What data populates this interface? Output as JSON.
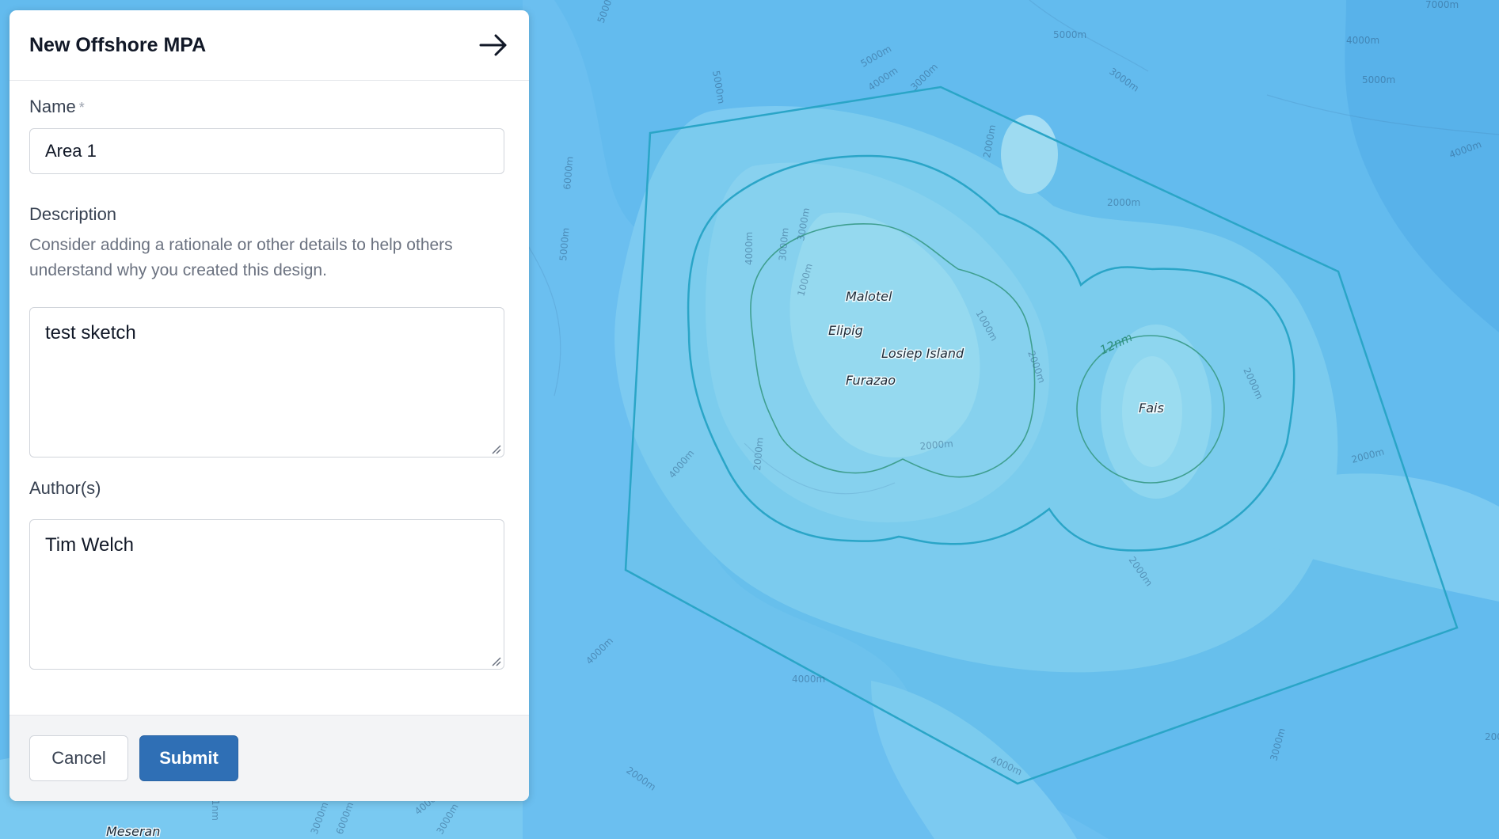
{
  "map": {
    "places": [
      "Malotel",
      "Elipig",
      "Losiep Island",
      "Furazao",
      "Fais",
      "Meseran"
    ],
    "nm_label": "12nm",
    "contour_labels": [
      "5000m",
      "4000m",
      "3000m",
      "2000m",
      "1000m",
      "7000m",
      "6000m",
      "1nm"
    ],
    "colors": {
      "deep": "#5bb6ec",
      "mid": "#72c4f0",
      "shallow": "#92d4f3",
      "outline": "#2aa5c7",
      "inner_outline": "#3f9f90"
    }
  },
  "panel": {
    "title": "New Offshore MPA",
    "collapse_icon": "arrow-right-icon",
    "name_label": "Name",
    "required_mark": "*",
    "name_value": "Area 1",
    "description_label": "Description",
    "description_help": "Consider adding a rationale or other details to help others understand why you created this design.",
    "description_value": "test sketch",
    "authors_label": "Author(s)",
    "authors_value": "Tim Welch",
    "cancel_label": "Cancel",
    "submit_label": "Submit"
  }
}
